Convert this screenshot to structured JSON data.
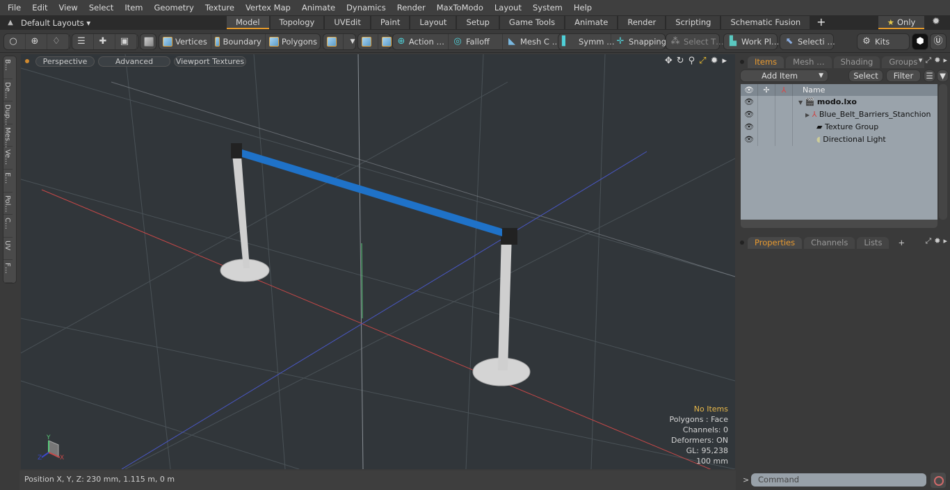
{
  "menu": [
    "File",
    "Edit",
    "View",
    "Select",
    "Item",
    "Geometry",
    "Texture",
    "Vertex Map",
    "Animate",
    "Dynamics",
    "Render",
    "MaxToModo",
    "Layout",
    "System",
    "Help"
  ],
  "layouts": {
    "label": "Default Layouts ▾",
    "tabs": [
      "Model",
      "Topology",
      "UVEdit",
      "Paint",
      "Layout",
      "Setup",
      "Game Tools",
      "Animate",
      "Render",
      "Scripting",
      "Schematic Fusion"
    ],
    "active_tab": "Model",
    "add": "+",
    "only_label": "Only"
  },
  "toolbar": {
    "vertices": "Vertices",
    "boundary": "Boundary",
    "polygons": "Polygons",
    "action": "Action   …",
    "falloff": "Falloff",
    "mesh_c": "Mesh C …",
    "symm": "Symm …",
    "snapping": "Snapping",
    "select_t": "Select T…",
    "work_pl": "Work Pl…",
    "selecti": "Selecti …",
    "kits": "Kits"
  },
  "left_tabs": [
    "B…",
    "De…",
    "Dup…",
    "Mes…",
    "Ve…",
    "E…",
    "Pol…",
    "C…",
    "UV",
    "F…"
  ],
  "viewport": {
    "view_mode": "Perspective",
    "advanced": "Advanced",
    "textures": "Viewport Textures",
    "hud": {
      "selection": "No Items",
      "polygons": "Polygons : Face",
      "channels": "Channels: 0",
      "deformers": "Deformers: ON",
      "gl": "GL: 95,238",
      "scale": "100 mm"
    },
    "axis": {
      "x": "X",
      "y": "Y",
      "z": "Z"
    }
  },
  "status": "Position X, Y, Z:   230 mm, 1.115 m, 0 m",
  "items_panel": {
    "tabs": [
      "Items",
      "Mesh …",
      "Shading",
      "Groups"
    ],
    "active_tab": "Items",
    "add_item": "Add Item",
    "select": "Select",
    "filter": "Filter",
    "column_name": "Name",
    "tree": [
      {
        "name": "modo.lxo",
        "level": 0,
        "bold": true,
        "icon": "scene-icon"
      },
      {
        "name": "Blue_Belt_Barriers_Stanchion",
        "level": 1,
        "icon": "mesh-locator-icon"
      },
      {
        "name": "Texture Group",
        "level": 1,
        "icon": "folder-icon"
      },
      {
        "name": "Directional Light",
        "level": 1,
        "icon": "light-icon"
      }
    ]
  },
  "props_panel": {
    "tabs": [
      "Properties",
      "Channels",
      "Lists"
    ],
    "active_tab": "Properties",
    "add": "+"
  },
  "command": {
    "placeholder": "Command",
    "prompt": ">"
  },
  "colors": {
    "accent": "#e59a2b",
    "belt": "#1f72c8",
    "grid_x": "#c84848",
    "grid_z": "#4a58c8",
    "grid_y": "#58c878"
  }
}
